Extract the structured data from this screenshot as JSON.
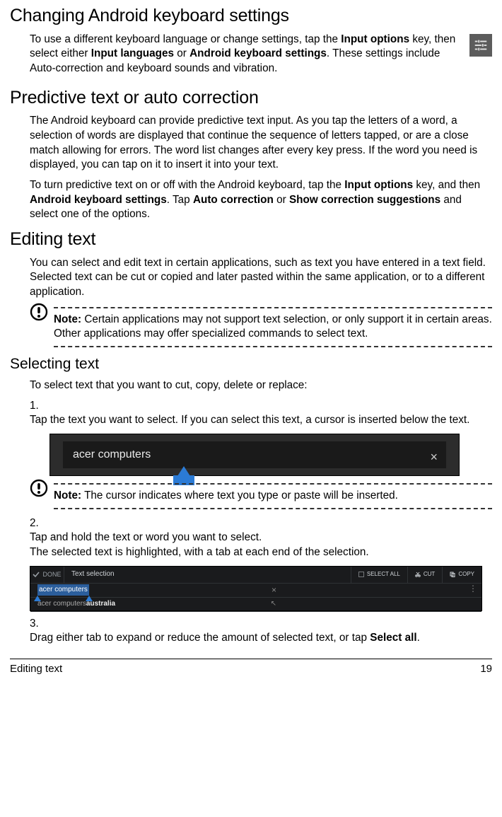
{
  "h1_changing": "Changing Android keyboard settings",
  "p_changing_1a": "To use a different keyboard language or change settings, tap the ",
  "p_changing_1b": "Input options",
  "p_changing_1c": " key, then select either ",
  "p_changing_1d": "Input languages",
  "p_changing_1e": " or ",
  "p_changing_1f": "Android keyboard settings",
  "p_changing_1g": ". These settings include Auto-correction and keyboard sounds and vibration.",
  "h1_predictive": "Predictive text or auto correction",
  "p_predictive_1": "The Android keyboard can provide predictive text input. As you tap the letters of a word, a selection of words are displayed that continue the sequence of letters tapped, or are a close match allowing for errors. The word list changes after every key press. If the word you need is displayed, you can tap on it to insert it into your text.",
  "p_predictive_2a": "To turn predictive text on or off with the Android keyboard, tap the ",
  "p_predictive_2b": "Input options",
  "p_predictive_2c": " key, and then ",
  "p_predictive_2d": "Android keyboard settings",
  "p_predictive_2e": ". Tap ",
  "p_predictive_2f": "Auto correction",
  "p_predictive_2g": " or ",
  "p_predictive_2h": "Show correction suggestions",
  "p_predictive_2i": " and select one of the options.",
  "h1_editing": "Editing text",
  "p_editing_1": "You can select and edit text in certain applications, such as text you have entered in a text field. Selected text can be cut or copied and later pasted within the same application, or to a different application.",
  "note1_label": "Note:",
  "note1_text": " Certain applications may not support text selection, or only support it in certain areas. Other applications may offer specialized commands to select text.",
  "h2_selecting": "Selecting text",
  "p_selecting_intro": "To select text that you want to cut, copy, delete or replace:",
  "li1_num": "1.",
  "li1_text": "Tap the text you want to select. If you can select this text, a cursor is inserted below the text.",
  "search_text": "acer computers",
  "note2_label": "Note:",
  "note2_text": " The cursor indicates where text you type or paste will be inserted.",
  "li2_num": "2.",
  "li2_text_a": "Tap and hold the text or word you want to select.",
  "li2_text_b": "The selected text is highlighted, with a tab at each end of the selection.",
  "sel_done": "DONE",
  "sel_title": "Text selection",
  "sel_all": "SELECT ALL",
  "sel_cut": "CUT",
  "sel_copy": "COPY",
  "sel_highlight": "acer computers",
  "sel_suggest_a": "acer computers ",
  "sel_suggest_b": "australia",
  "li3_num": "3.",
  "li3_text_a": "Drag either tab to expand or reduce the amount of selected text, or tap ",
  "li3_text_b": "Select all",
  "li3_text_c": ".",
  "footer_left": "Editing text",
  "footer_right": "19"
}
